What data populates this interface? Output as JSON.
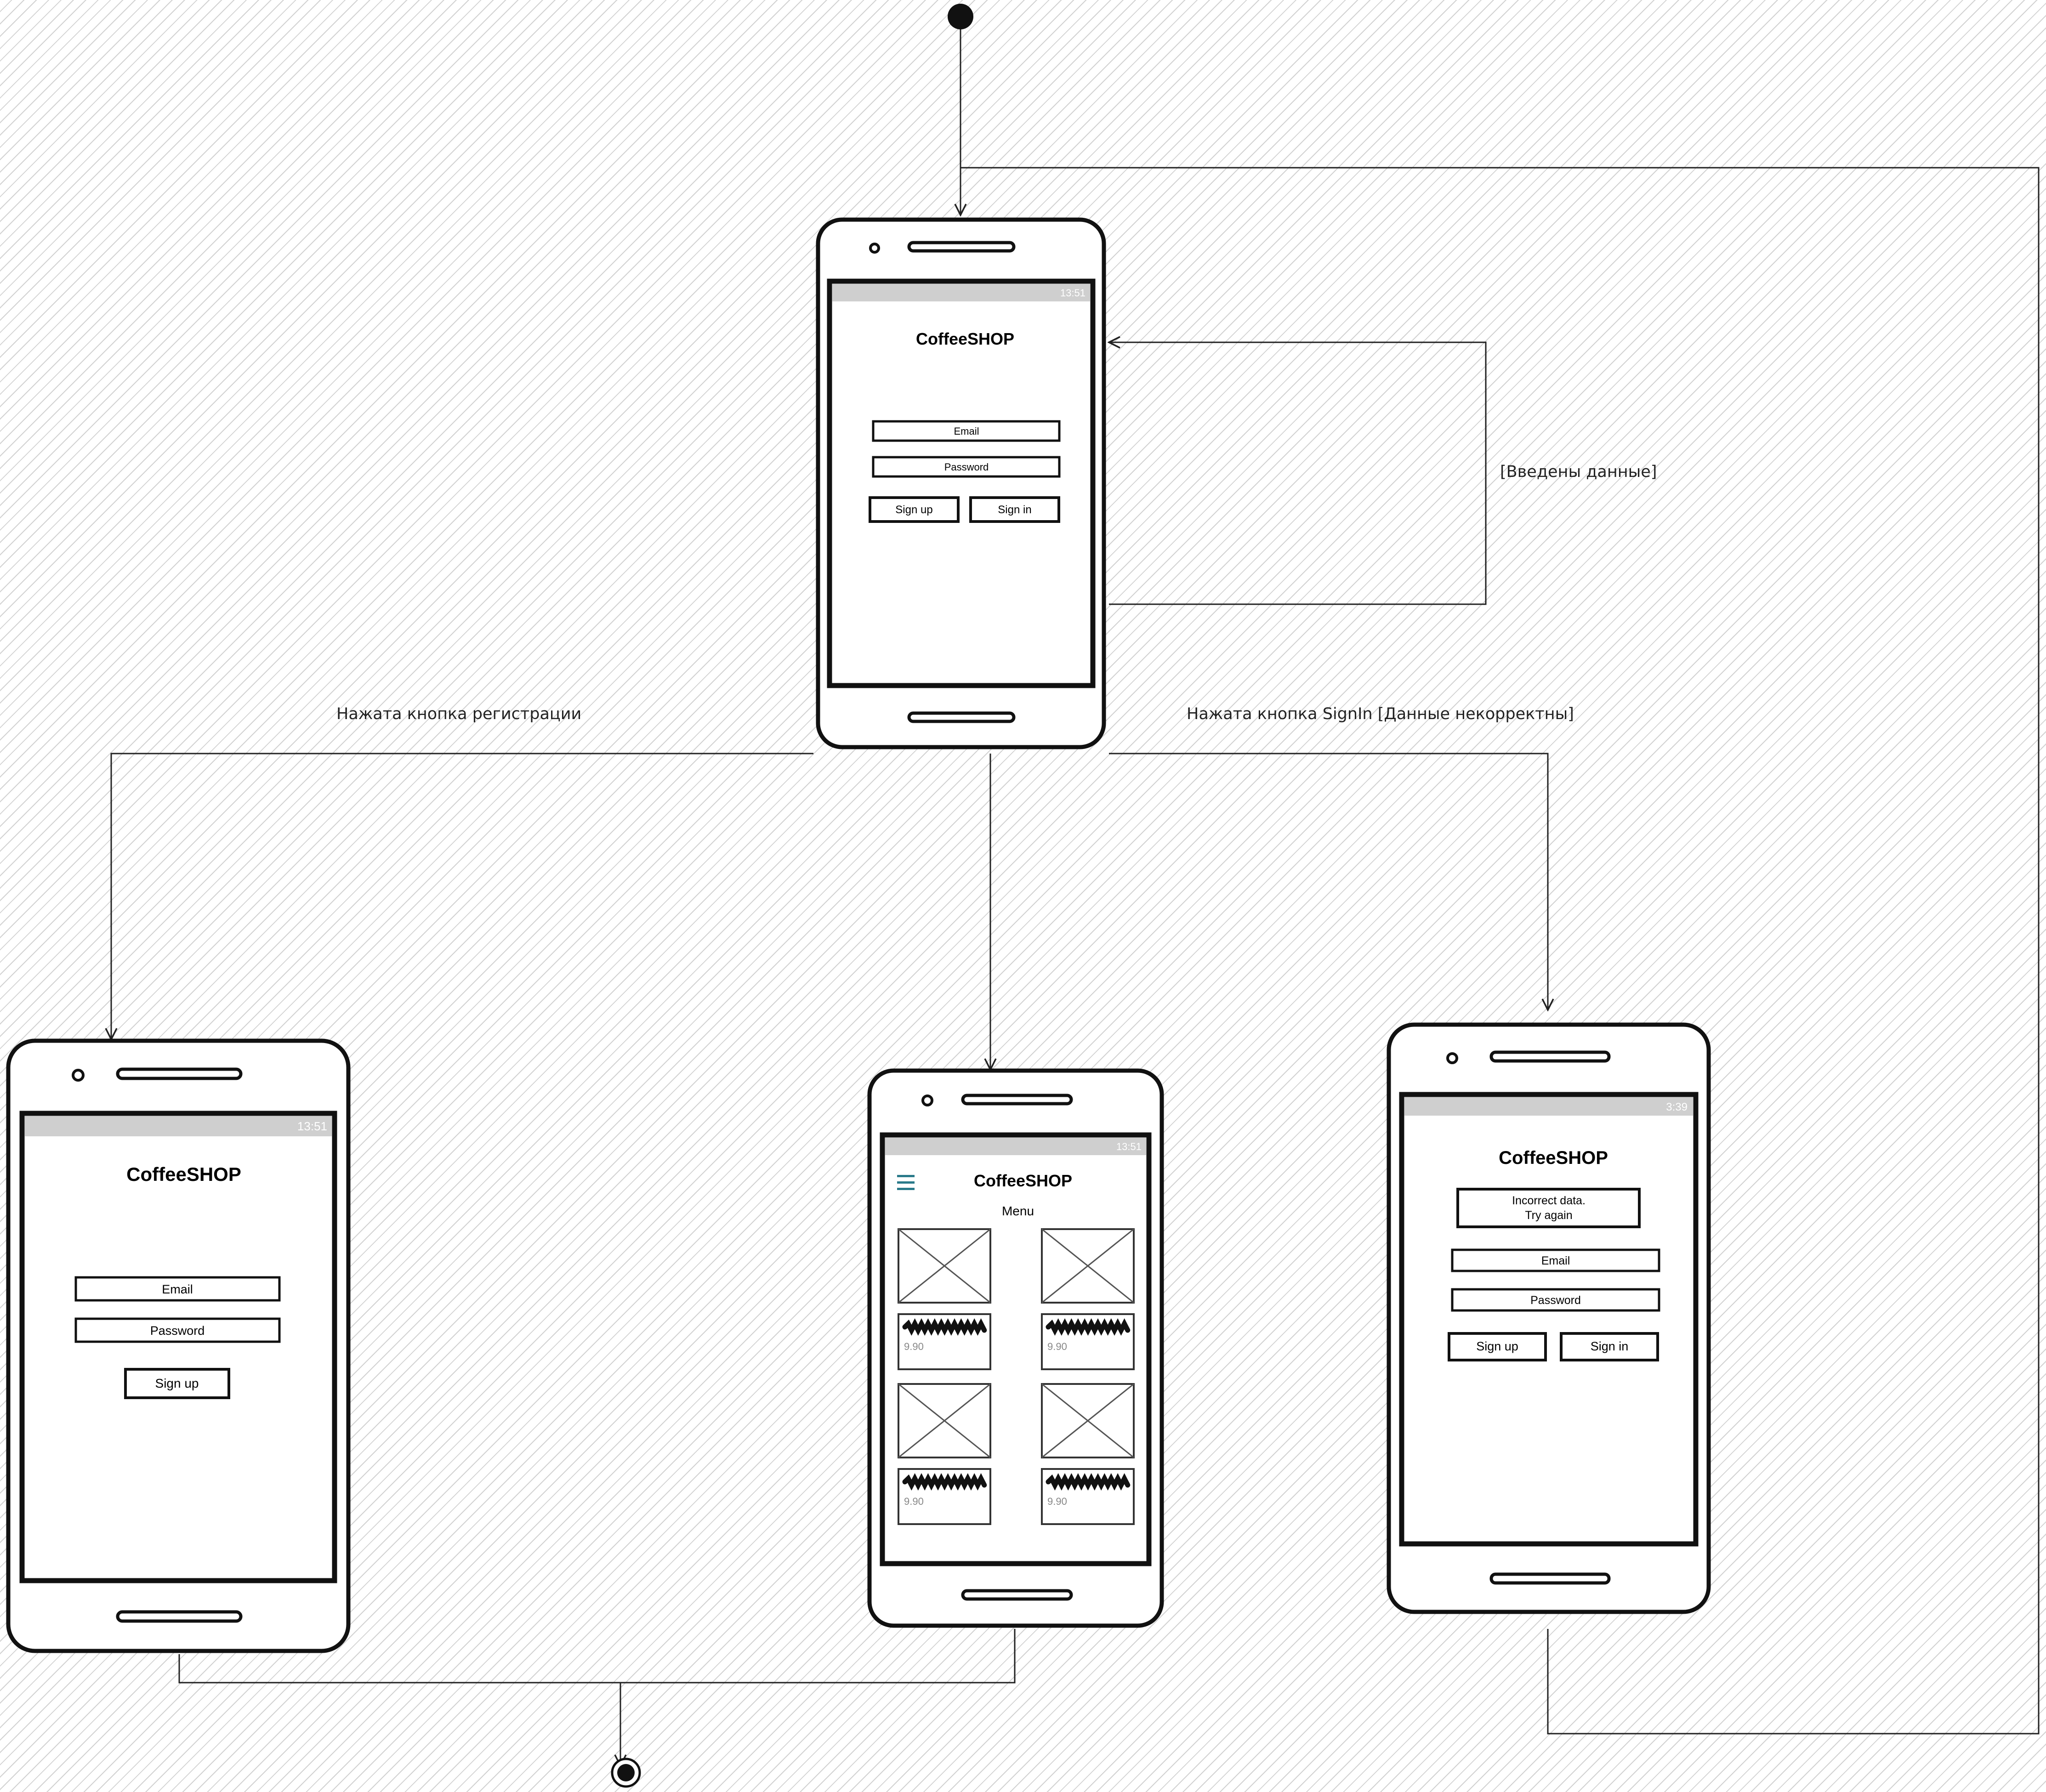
{
  "diagram": {
    "labels": {
      "self_loop": "[Введены данные]",
      "to_register": "Нажата кнопка регистрации",
      "to_error": "Нажата кнопка SignIn [Данные некорректны]"
    }
  },
  "screens": {
    "login": {
      "status_time": "13:51",
      "title": "CoffeeSHOP",
      "email_placeholder": "Email",
      "password_placeholder": "Password",
      "signup_label": "Sign up",
      "signin_label": "Sign in"
    },
    "register": {
      "status_time": "13:51",
      "title": "CoffeeSHOP",
      "email_placeholder": "Email",
      "password_placeholder": "Password",
      "signup_label": "Sign up"
    },
    "menu": {
      "status_time": "13:51",
      "menu_icon": "hamburger-icon",
      "title": "CoffeeSHOP",
      "subtitle": "Menu",
      "items": [
        {
          "price": "9.90"
        },
        {
          "price": "9.90"
        },
        {
          "price": "9.90"
        },
        {
          "price": "9.90"
        }
      ]
    },
    "error": {
      "status_time": "3:39",
      "title": "CoffeeSHOP",
      "message_line1": "Incorrect data.",
      "message_line2": "Try again",
      "email_placeholder": "Email",
      "password_placeholder": "Password",
      "signup_label": "Sign up",
      "signin_label": "Sign in"
    }
  },
  "colors": {
    "ink": "#111111",
    "status_bar": "#cfcfcf",
    "menu_icon": "#2a7a8a",
    "hatch": "#d2d2d2"
  }
}
